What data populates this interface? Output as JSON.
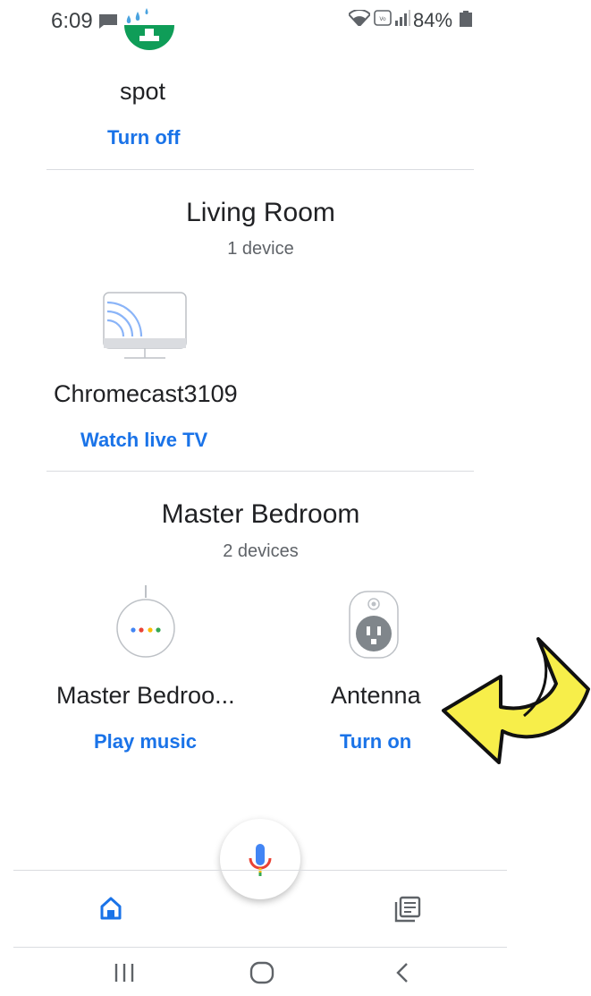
{
  "status_bar": {
    "time": "6:09",
    "battery_percent": "84%"
  },
  "rooms": [
    {
      "devices": [
        {
          "name": "spot",
          "action": "Turn off"
        }
      ]
    },
    {
      "title": "Living Room",
      "device_count": "1 device",
      "devices": [
        {
          "name": "Chromecast3109",
          "action": "Watch live TV"
        }
      ]
    },
    {
      "title": "Master Bedroom",
      "device_count": "2 devices",
      "devices": [
        {
          "name": "Master Bedroo...",
          "action": "Play music"
        },
        {
          "name": "Antenna",
          "action": "Turn on"
        }
      ]
    }
  ],
  "colors": {
    "accent_blue": "#1a73e8",
    "annotation_arrow": "#f7ee4a"
  },
  "icons": {
    "home_tab": "home-icon",
    "feed_tab": "feed-icon",
    "mic": "mic-icon"
  }
}
